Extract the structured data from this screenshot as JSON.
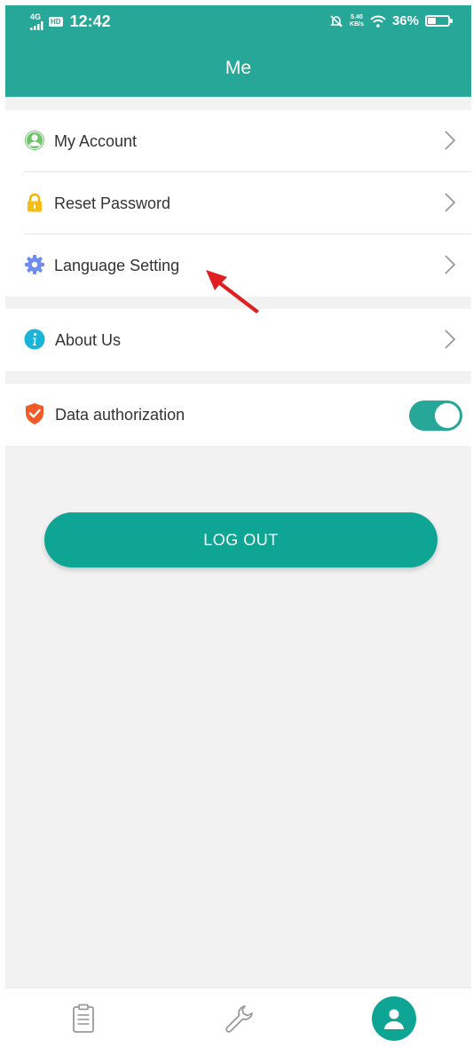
{
  "status_bar": {
    "network": "4G",
    "hd": "HD",
    "time": "12:42",
    "speed_value": "5.40",
    "speed_unit": "KB/s",
    "battery": "36%",
    "battery_level": 0.36
  },
  "header": {
    "title": "Me"
  },
  "menu": {
    "my_account": "My Account",
    "reset_password": "Reset Password",
    "language_setting": "Language Setting",
    "about_us": "About Us",
    "data_authorization": "Data authorization",
    "data_authorization_enabled": true
  },
  "logout_label": "LOG OUT",
  "tabs": [
    {
      "icon": "clipboard-icon",
      "active": false
    },
    {
      "icon": "wrench-icon",
      "active": false
    },
    {
      "icon": "person-icon",
      "active": true
    }
  ],
  "colors": {
    "brand": "#27a797",
    "button": "#0ea594",
    "background": "#f2f2f2",
    "annotation": "#e02020"
  },
  "icons": {
    "my_account": "user-circle-icon",
    "reset_password": "lock-icon",
    "language_setting": "gear-icon",
    "about_us": "info-icon",
    "data_authorization": "shield-check-icon"
  }
}
